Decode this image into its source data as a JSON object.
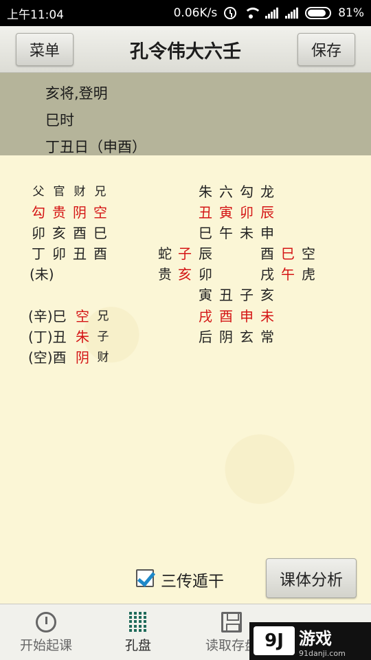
{
  "status_bar": {
    "time": "上午11:04",
    "speed": "0.06K/s",
    "battery": "81%"
  },
  "title_bar": {
    "menu_label": "菜单",
    "title": "孔令伟大六壬",
    "save_label": "保存"
  },
  "info": {
    "line1": "亥将,登明",
    "line2": "巳时",
    "line3": "丁丑日（申酉）"
  },
  "board": {
    "left_header": [
      "父",
      "官",
      "财",
      "兄"
    ],
    "left_gods": [
      "勾",
      "贵",
      "阴",
      "空"
    ],
    "left_row3": [
      "卯",
      "亥",
      "酉",
      "巳"
    ],
    "left_row4": [
      "丁",
      "卯",
      "丑",
      "酉"
    ],
    "left_row5": "(未)",
    "chuan": [
      {
        "prefix": "(辛)巳",
        "god": "空",
        "rel": "兄"
      },
      {
        "prefix": "(丁)丑",
        "god": "朱",
        "rel": "子"
      },
      {
        "prefix": "(空)酉",
        "god": "阴",
        "rel": "财"
      }
    ],
    "right_row1": [
      "朱",
      "六",
      "勾",
      "龙"
    ],
    "right_row2": [
      "丑",
      "寅",
      "卯",
      "辰"
    ],
    "right_row3": [
      "巳",
      "午",
      "未",
      "申"
    ],
    "right_row4": {
      "g1": "蛇",
      "g2": "子",
      "g3": "辰",
      "g4": "酉",
      "g5": "巳",
      "g6": "空"
    },
    "right_row5": {
      "g1": "贵",
      "g2": "亥",
      "g3": "卯",
      "g4": "戌",
      "g5": "午",
      "g6": "虎"
    },
    "right_row6": [
      "寅",
      "丑",
      "子",
      "亥"
    ],
    "right_row7": [
      "戌",
      "酉",
      "申",
      "未"
    ],
    "right_row8": [
      "后",
      "阴",
      "玄",
      "常"
    ]
  },
  "controls": {
    "checkbox_label": "三传遁干",
    "analysis_label": "课体分析"
  },
  "bottom_nav": {
    "items": [
      {
        "label": "开始起课"
      },
      {
        "label": "孔盘"
      },
      {
        "label": "读取存盘"
      }
    ]
  },
  "watermark": {
    "badge": "9J",
    "name": "游戏",
    "url": "91danji.com"
  },
  "colors": {
    "accent_red": "#d41414",
    "info_band": "#b5b49a",
    "board_bg": "#fbf6d6"
  }
}
